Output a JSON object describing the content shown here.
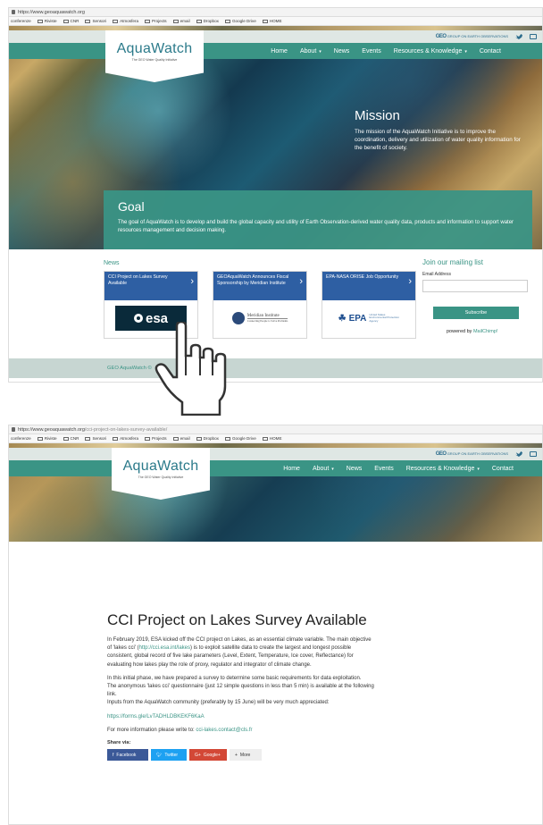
{
  "screen1": {
    "url": "https://www.geoaquawatch.org",
    "bookmarks": [
      "conferenze",
      "Riviste",
      "CNR",
      "Sensori",
      "Atmosfera",
      "Projects",
      "email",
      "Dropbox",
      "Google Drive",
      "HOME"
    ],
    "geo_logo": "GEO",
    "geo_logo_sub": "GROUP ON EARTH OBSERVATIONS",
    "nav": {
      "home": "Home",
      "about": "About",
      "news": "News",
      "events": "Events",
      "resources": "Resources & Knowledge",
      "contact": "Contact"
    },
    "logo": {
      "title": "AquaWatch",
      "subtitle": "The GEO Water Quality Initiative"
    },
    "mission": {
      "title": "Mission",
      "text": "The mission of the AquaWatch Initiative is to improve the coordination, delivery and utilization of water quality information for the benefit of society."
    },
    "goal": {
      "title": "Goal",
      "text": "The goal of AquaWatch is to develop and build the global capacity and utility of Earth Observation-derived water quality data, products and information to support water resources management and decision making."
    },
    "news_heading": "News",
    "news": [
      {
        "title": "CCI Project on Lakes Survey Available",
        "logo": "esa"
      },
      {
        "title": "GEOAquaWatch Announces Fiscal Sponsorship by Meridian Institute",
        "logo": "Meridian Institute",
        "logo_sub": "Connecting People to Solve Problems"
      },
      {
        "title": "EPA-NASA ORISE Job Opportunity",
        "logo": "EPA",
        "logo_sub": "United States Environmental Protection Agency"
      }
    ],
    "mailing": {
      "title": "Join our mailing list",
      "email_label": "Email Address",
      "subscribe": "Subscribe",
      "powered_prefix": "powered by",
      "powered_link": "MailChimp!"
    },
    "footer": {
      "left": "GEO AquaWatch ©",
      "author": "admin"
    }
  },
  "screen2": {
    "url_base": "https://www.geoaquawatch.org",
    "url_path": "/cci-project-on-lakes-survey-available/",
    "article": {
      "title": "CCI Project on Lakes Survey Available",
      "p1_pre": "In February 2019, ESA kicked off the CCI project on Lakes, as an essential climate variable. The main objective of 'lakes cci' (",
      "p1_link": "http://cci.esa.int/lakes",
      "p1_post": ") is to exploit satellite data to create the largest and longest possible consistent, global record of five lake parameters (Level, Extent, Temperature, Ice cover, Reflectance) for evaluating how lakes play the role of proxy, regulator and integrator of climate change.",
      "p2": "In this initial phase, we have prepared a survey to determine some basic requirements for data exploitation.",
      "p3": "The anonymous 'lakes cci' questionnaire (just 12 simple questions in less than 5 min) is available at the following link.",
      "p4": "Inputs from the AquaWatch community (preferably by 15 June) will be very much appreciated:",
      "form_link": "https://forms.gle/LvTADHLDBKEKF6KaA",
      "contact_pre": "For more information please write to: ",
      "contact_email": "cci-lakes.contact@cls.fr",
      "share_label": "Share via:",
      "share": {
        "facebook": "Facebook",
        "twitter": "Twitter",
        "google": "Google+",
        "more": "More"
      }
    }
  }
}
